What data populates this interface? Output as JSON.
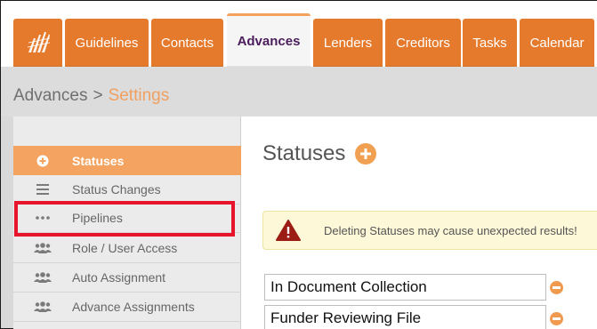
{
  "nav": {
    "logo_icon": "company-logo-icon",
    "tabs": [
      {
        "label": "Guidelines"
      },
      {
        "label": "Contacts"
      },
      {
        "label": "Advances"
      },
      {
        "label": "Lenders"
      },
      {
        "label": "Creditors"
      },
      {
        "label": "Tasks"
      },
      {
        "label": "Calendar"
      }
    ],
    "active_tab": "Advances"
  },
  "breadcrumb": {
    "parent": "Advances",
    "separator": ">",
    "current": "Settings"
  },
  "sidebar": {
    "active_item": "Statuses",
    "highlighted_item": "Pipelines",
    "items": [
      {
        "label": "Statuses",
        "icon": "plus-circle-icon"
      },
      {
        "label": "Status Changes",
        "icon": "list-icon"
      },
      {
        "label": "Pipelines",
        "icon": "ellipsis-icon"
      },
      {
        "label": "Role / User Access",
        "icon": "users-icon"
      },
      {
        "label": "Auto Assignment",
        "icon": "users-icon"
      },
      {
        "label": "Advance Assignments",
        "icon": "users-icon"
      }
    ]
  },
  "main": {
    "title": "Statuses",
    "warning": "Deleting Statuses may cause unexpected results!",
    "statuses": [
      {
        "value": "In Document Collection"
      },
      {
        "value": "Funder Reviewing File"
      }
    ]
  },
  "colors": {
    "nav_orange": "#e57a2c",
    "sidebar_active": "#f4a460",
    "highlight_red": "#e8142c",
    "warning_bg": "#fcf8d8"
  }
}
